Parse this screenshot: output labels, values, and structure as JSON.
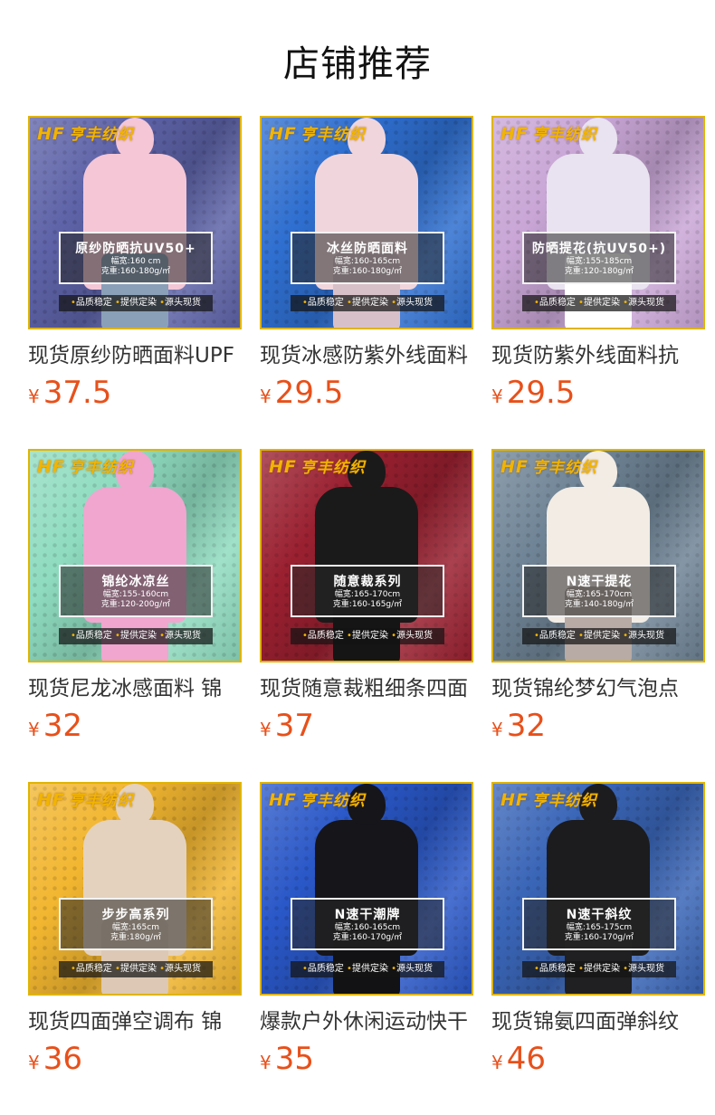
{
  "section_title": "店铺推荐",
  "brand_logo": "亨丰纺织",
  "brand_mark": "HF",
  "accent_color": "#e8501a",
  "products": [
    {
      "title": "现货原纱防晒面料UPF",
      "currency": "¥",
      "price": "37.5",
      "badge_name": "原纱防晒抗UV50+",
      "spec_width": "幅宽:160  cm",
      "spec_weight": "克重:160-180g/㎡",
      "tags": [
        "品质稳定",
        "提供定染",
        "源头现货"
      ]
    },
    {
      "title": "现货冰感防紫外线面料",
      "currency": "¥",
      "price": "29.5",
      "badge_name": "冰丝防晒面料",
      "spec_width": "幅宽:160-165cm",
      "spec_weight": "克重:160-180g/㎡",
      "tags": [
        "品质稳定",
        "提供定染",
        "源头现货"
      ]
    },
    {
      "title": "现货防紫外线面料抗",
      "currency": "¥",
      "price": "29.5",
      "badge_name": "防晒提花(抗UV50+)",
      "spec_width": "幅宽:155-185cm",
      "spec_weight": "克重:120-180g/㎡",
      "tags": [
        "品质稳定",
        "提供定染",
        "源头现货"
      ]
    },
    {
      "title": "现货尼龙冰感面料 锦",
      "currency": "¥",
      "price": "32",
      "badge_name": "锦纶冰凉丝",
      "spec_width": "幅宽:155-160cm",
      "spec_weight": "克重:120-200g/㎡",
      "tags": [
        "品质稳定",
        "提供定染",
        "源头现货"
      ]
    },
    {
      "title": "现货随意裁粗细条四面",
      "currency": "¥",
      "price": "37",
      "badge_name": "随意裁系列",
      "spec_width": "幅宽:165-170cm",
      "spec_weight": "克重:160-165g/㎡",
      "tags": [
        "品质稳定",
        "提供定染",
        "源头现货"
      ]
    },
    {
      "title": "现货锦纶梦幻气泡点",
      "currency": "¥",
      "price": "32",
      "badge_name": "N速干提花",
      "spec_width": "幅宽:165-170cm",
      "spec_weight": "克重:140-180g/㎡",
      "tags": [
        "品质稳定",
        "提供定染",
        "源头现货"
      ]
    },
    {
      "title": "现货四面弹空调布 锦",
      "currency": "¥",
      "price": "36",
      "badge_name": "步步高系列",
      "spec_width": "幅宽:165cm",
      "spec_weight": "克重:180g/㎡",
      "tags": [
        "品质稳定",
        "提供定染",
        "源头现货"
      ]
    },
    {
      "title": "爆款户外休闲运动快干",
      "currency": "¥",
      "price": "35",
      "badge_name": "N速干潮牌",
      "spec_width": "幅宽:160-165cm",
      "spec_weight": "克重:160-170g/㎡",
      "tags": [
        "品质稳定",
        "提供定染",
        "源头现货"
      ]
    },
    {
      "title": "现货锦氨四面弹斜纹",
      "currency": "¥",
      "price": "46",
      "badge_name": "N速干斜纹",
      "spec_width": "幅宽:165-175cm",
      "spec_weight": "克重:160-170g/㎡",
      "tags": [
        "品质稳定",
        "提供定染",
        "源头现货"
      ]
    }
  ],
  "thumb_colors": [
    {
      "fabric": "#5e63a8",
      "garment": "#f4c6d6",
      "legs": "#8aa0b8"
    },
    {
      "fabric": "#2f6fd0",
      "garment": "#f0d6dc",
      "legs": "#d8c0c8"
    },
    {
      "fabric": "#c9a6d6",
      "garment": "#e9e2f0",
      "legs": "#ffffff"
    },
    {
      "fabric": "#8fdcc0",
      "garment": "#f0a6cf",
      "legs": "#f0a6cf"
    },
    {
      "fabric": "#9a2030",
      "garment": "#1a1a1a",
      "legs": "#151515"
    },
    {
      "fabric": "#6f8496",
      "garment": "#f2ece4",
      "legs": "#b8aaa4"
    },
    {
      "fabric": "#f2b630",
      "garment": "#e4d2be",
      "legs": "#dcc8b4"
    },
    {
      "fabric": "#2a58c8",
      "garment": "#15151a",
      "legs": "#121214"
    },
    {
      "fabric": "#3a66b8",
      "garment": "#1c1c1e",
      "legs": "#202022"
    }
  ]
}
